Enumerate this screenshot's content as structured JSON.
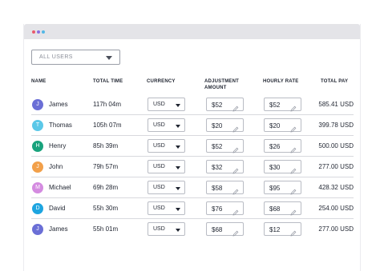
{
  "filter": {
    "selected": "ALL USERS"
  },
  "headers": {
    "name": "NAME",
    "total_time": "TOTAL TIME",
    "currency": "CURRENCY",
    "adjustment_line1": "ADJUSTMENT",
    "adjustment_line2": "AMOUNT",
    "hourly_rate": "HOURLY RATE",
    "total_pay": "TOTAL PAY"
  },
  "rows": [
    {
      "initial": "J",
      "avatar_color": "#6b6fd6",
      "name": "James",
      "total_time": "117h 04m",
      "currency": "USD",
      "adjustment": "$52",
      "hourly_rate": "$52",
      "total_pay": "585.41 USD"
    },
    {
      "initial": "T",
      "avatar_color": "#5bc8e8",
      "name": "Thomas",
      "total_time": "105h 07m",
      "currency": "USD",
      "adjustment": "$20",
      "hourly_rate": "$20",
      "total_pay": "399.78 USD"
    },
    {
      "initial": "H",
      "avatar_color": "#19a37d",
      "name": "Henry",
      "total_time": "85h 39m",
      "currency": "USD",
      "adjustment": "$52",
      "hourly_rate": "$26",
      "total_pay": "500.00 USD"
    },
    {
      "initial": "J",
      "avatar_color": "#f2a04a",
      "name": "John",
      "total_time": "79h 57m",
      "currency": "USD",
      "adjustment": "$32",
      "hourly_rate": "$30",
      "total_pay": "277.00 USD"
    },
    {
      "initial": "M",
      "avatar_color": "#d48be0",
      "name": "Michael",
      "total_time": "69h 28m",
      "currency": "USD",
      "adjustment": "$58",
      "hourly_rate": "$95",
      "total_pay": "428.32 USD"
    },
    {
      "initial": "D",
      "avatar_color": "#1ea5e0",
      "name": "David",
      "total_time": "55h 30m",
      "currency": "USD",
      "adjustment": "$76",
      "hourly_rate": "$68",
      "total_pay": "254.00 USD"
    },
    {
      "initial": "J",
      "avatar_color": "#6b6fd6",
      "name": "James",
      "total_time": "55h 01m",
      "currency": "USD",
      "adjustment": "$68",
      "hourly_rate": "$12",
      "total_pay": "277.00 USD"
    }
  ],
  "icons": {
    "window_dots": [
      "close-dot",
      "minimize-dot",
      "maximize-dot"
    ],
    "edit": "pencil-icon",
    "dropdown": "chevron-down-icon"
  },
  "colors": {
    "titlebar": "#e4e4e8",
    "dot_red": "#e95a6c",
    "dot_purple": "#8a6fe0",
    "dot_blue": "#53b8e6",
    "row_divider": "#d8d9de"
  }
}
